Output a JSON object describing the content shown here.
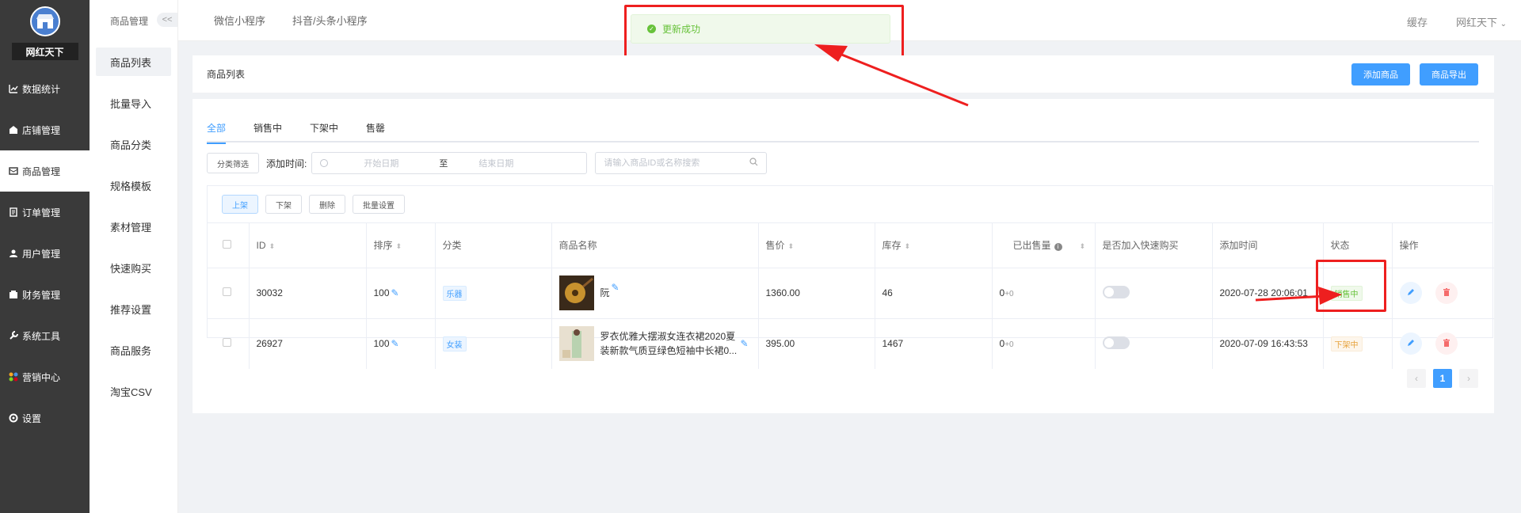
{
  "sidebar": {
    "shop_name": "网红天下",
    "items": [
      {
        "label": "数据统计",
        "icon": "chart-icon"
      },
      {
        "label": "店铺管理",
        "icon": "store-icon"
      },
      {
        "label": "商品管理",
        "icon": "goods-icon"
      },
      {
        "label": "订单管理",
        "icon": "order-icon"
      },
      {
        "label": "用户管理",
        "icon": "user-icon"
      },
      {
        "label": "财务管理",
        "icon": "wallet-icon"
      },
      {
        "label": "系统工具",
        "icon": "wrench-icon"
      },
      {
        "label": "营销中心",
        "icon": "marketing-icon"
      },
      {
        "label": "设置",
        "icon": "gear-icon"
      }
    ],
    "active_index": 2
  },
  "subbar": {
    "title": "商品管理",
    "collapse_label": "<<",
    "items": [
      "商品列表",
      "批量导入",
      "商品分类",
      "规格模板",
      "素材管理",
      "快速购买",
      "推荐设置",
      "商品服务",
      "淘宝CSV"
    ],
    "active_index": 0
  },
  "topbar": {
    "tabs": [
      "微信小程序",
      "抖音/头条小程序"
    ],
    "cache_label": "缓存",
    "user_label": "网红天下"
  },
  "toast": {
    "message": "更新成功",
    "color": "#67c23a"
  },
  "page_head": {
    "title": "商品列表",
    "add_button": "添加商品",
    "export_button": "商品导出"
  },
  "tabs": {
    "items": [
      "全部",
      "销售中",
      "下架中",
      "售罄"
    ],
    "active_index": 0
  },
  "filters": {
    "category_button": "分类筛选",
    "date_label": "添加时间:",
    "date_start_placeholder": "开始日期",
    "date_separator": "至",
    "date_end_placeholder": "结束日期",
    "search_placeholder": "请输入商品ID或名称搜索"
  },
  "batch": {
    "buttons": [
      "上架",
      "下架",
      "删除",
      "批量设置"
    ],
    "active_index": 0
  },
  "table": {
    "headers": [
      "ID",
      "排序",
      "分类",
      "商品名称",
      "售价",
      "库存",
      "已出售量",
      "是否加入快速购买",
      "添加时间",
      "状态",
      "操作"
    ],
    "rows": [
      {
        "id": "30032",
        "sort": "100",
        "category": "乐器",
        "name": "阮",
        "price": "1360.00",
        "stock": "46",
        "sold": "0",
        "sold_extra": "+0",
        "quick_buy": false,
        "time": "2020-07-28 20:06:01",
        "status": "销售中",
        "status_type": "on"
      },
      {
        "id": "26927",
        "sort": "100",
        "category": "女装",
        "name": "罗衣优雅大摆淑女连衣裙2020夏装新款气质豆绿色短袖中长裙0...",
        "price": "395.00",
        "stock": "1467",
        "sold": "0",
        "sold_extra": "+0",
        "quick_buy": false,
        "time": "2020-07-09 16:43:53",
        "status": "下架中",
        "status_type": "off"
      }
    ]
  },
  "pager": {
    "current": "1",
    "prev": "‹",
    "next": "›"
  },
  "colors": {
    "primary": "#409eff",
    "highlight": "#ee1f1f",
    "success": "#67c23a",
    "warning": "#e6a23c"
  }
}
